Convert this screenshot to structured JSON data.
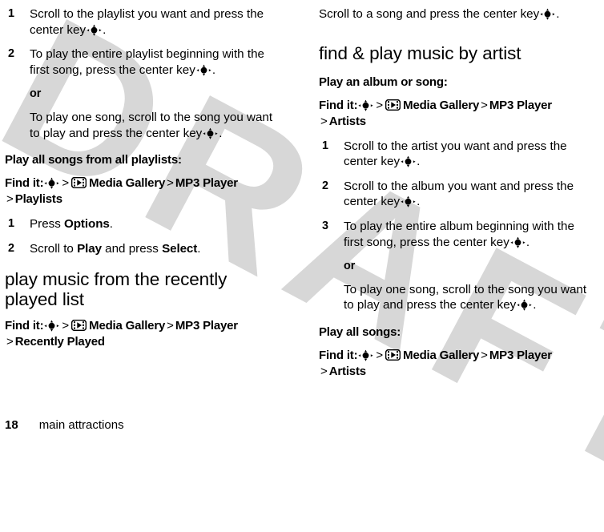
{
  "document": {
    "page_number": "18",
    "footer_label": "main attractions",
    "watermark_text": "DRAFT",
    "watermark_color": "#d7d7d7"
  },
  "icons": {
    "center_key": "center-key-icon",
    "media_gallery": "media-gallery-icon"
  },
  "left_column": {
    "step_1": {
      "num": "1",
      "text_before": "Scroll to the playlist you want and press the center key",
      "text_after": "."
    },
    "step_2": {
      "num": "2",
      "text_before": "To play the entire playlist beginning with the first song, press the center key",
      "text_after": "."
    },
    "or_label": "or",
    "step_2_alt": {
      "text_before": "To play one song, scroll to the song you want to play and press the center key",
      "text_after": "."
    },
    "subhead_play_all": "Play all songs from all playlists:",
    "findit_playlists": {
      "label": "Find it:",
      "sep": ">",
      "media_gallery": "Media Gallery",
      "mp3_player": "MP3 Player",
      "leaf": "Playlists"
    },
    "step_options": {
      "num": "1",
      "text_before": "Press ",
      "term": "Options",
      "text_after": "."
    },
    "step_play_select": {
      "num": "2",
      "text_before": "Scroll to ",
      "term_1": "Play",
      "text_mid": " and press ",
      "term_2": "Select",
      "text_after": "."
    },
    "section_recently_played": "play music from the recently played list",
    "findit_recently_played": {
      "label": "Find it:",
      "sep": ">",
      "media_gallery": "Media Gallery",
      "mp3_player": "MP3 Player",
      "leaf": "Recently Played"
    }
  },
  "right_column": {
    "intro": {
      "text_before": "Scroll to a song and press the center key",
      "text_after": "."
    },
    "section_find_play_artist": "find & play music by artist",
    "subhead_album_or_song": "Play an album or song:",
    "findit_artists_1": {
      "label": "Find it:",
      "sep": ">",
      "media_gallery": "Media Gallery",
      "mp3_player": "MP3 Player",
      "leaf": "Artists"
    },
    "step_1": {
      "num": "1",
      "text_before": "Scroll to the artist you want and press the center key",
      "text_after": "."
    },
    "step_2": {
      "num": "2",
      "text_before": "Scroll to the album you want and press the center key",
      "text_after": "."
    },
    "step_3": {
      "num": "3",
      "text_before": "To play the entire album beginning with the first song, press the center key",
      "text_after": "."
    },
    "or_label": "or",
    "step_3_alt": {
      "text_before": "To play one song, scroll to the song you want to play and press the center key",
      "text_after": "."
    },
    "subhead_play_all_songs": "Play all songs:",
    "findit_artists_2": {
      "label": "Find it:",
      "sep": ">",
      "media_gallery": "Media Gallery",
      "mp3_player": "MP3 Player",
      "leaf": "Artists"
    }
  }
}
